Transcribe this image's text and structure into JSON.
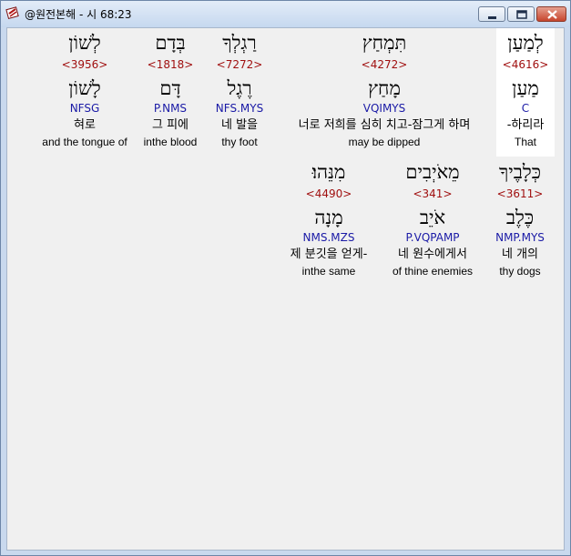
{
  "window": {
    "title": "@원전본해 - 시 68:23"
  },
  "caption_buttons": {
    "minimize": "minimize-icon",
    "maximize": "maximize-icon",
    "close": "close-icon"
  },
  "rows": [
    {
      "words": [
        {
          "hebrew": "לְמַעַן",
          "strong": "<4616>",
          "lemma": "מַעַן",
          "morph": "C",
          "korean": "-하리라",
          "english": "That"
        },
        {
          "hebrew": "תִּמְחַץ",
          "strong": "<4272>",
          "lemma": "מָחַץ",
          "morph": "VQIMYS",
          "korean": "너로 저희를 심히 치고-잠그게 하며",
          "english": "may be dipped"
        },
        {
          "hebrew": "רַגְלְךָ",
          "strong": "<7272>",
          "lemma": "רֶגֶל",
          "morph": "NFS.MYS",
          "korean": "네 발을",
          "english": "thy foot"
        },
        {
          "hebrew": "בְּדָם",
          "strong": "<1818>",
          "lemma": "דָּם",
          "morph": "P.NMS",
          "korean": "그 피에",
          "english": "inthe blood"
        },
        {
          "hebrew": "לְשׁוֹן",
          "strong": "<3956>",
          "lemma": "לָשׁוֹן",
          "morph": "NFSG",
          "korean": "혀로",
          "english": "and the tongue of"
        }
      ]
    },
    {
      "words": [
        {
          "hebrew": "כְּלָבֶיךָ",
          "strong": "<3611>",
          "lemma": "כֶּלֶב",
          "morph": "NMP.MYS",
          "korean": "네 개의",
          "english": "thy dogs"
        },
        {
          "hebrew": "מֵאֹיְבִים",
          "strong": "<341>",
          "lemma": "אֹיֵב",
          "morph": "P.VQPAMP",
          "korean": "네 원수에게서",
          "english": "of thine enemies"
        },
        {
          "hebrew": "מִנֵּהוּ׃",
          "strong": "<4490>",
          "lemma": "מָנָה",
          "morph": "NMS.MZS",
          "korean": "제 분깃을 얻게-",
          "english": "inthe same"
        }
      ]
    }
  ]
}
